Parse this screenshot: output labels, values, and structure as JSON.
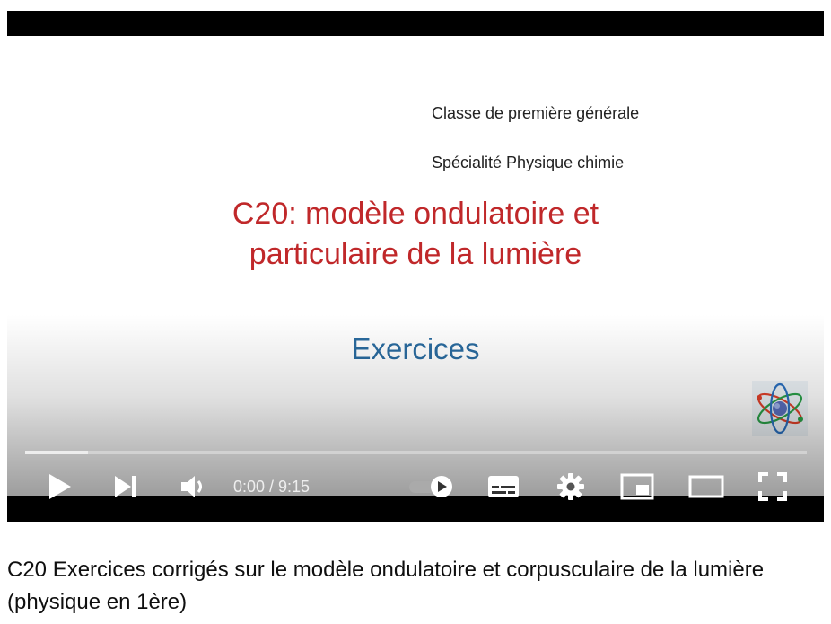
{
  "slide": {
    "line1": "Classe de première générale",
    "line2": "Spécialité Physique chimie",
    "title_line1": "C20: modèle ondulatoire et",
    "title_line2": "particulaire de la lumière",
    "section": "Exercices",
    "logo_icon": "atom-logo-icon"
  },
  "player": {
    "time": "0:00 / 9:15",
    "progress_loaded": 0.08,
    "icons": [
      "play-icon",
      "next-icon",
      "volume-icon",
      "autoplay-toggle-icon",
      "subtitles-icon",
      "settings-gear-icon",
      "miniplayer-icon",
      "theater-mode-icon",
      "fullscreen-icon"
    ]
  },
  "video_title": "C20 Exercices corrigés sur le modèle ondulatoire et corpusculaire de la lumière (physique en 1ère)"
}
